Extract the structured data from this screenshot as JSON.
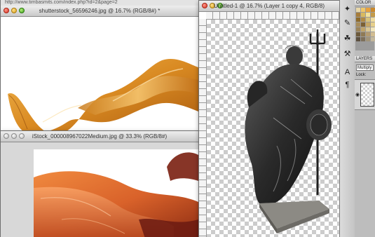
{
  "shutter_window": {
    "url_text": "http://www.timbasmits.com/index.php?id=2&page=2",
    "title": "shutterstock_56596246.jpg @ 16.7% (RGB/8#) *"
  },
  "istock_window": {
    "title": "iStock_000008967022Medium.jpg @ 33.3% (RGB/8#)"
  },
  "untitled_window": {
    "title": "Untitled-1 @ 16.7% (Layer 1 copy 4, RGB/8)"
  },
  "tools": [
    {
      "icon": "character-icon",
      "glyph": "✦"
    },
    {
      "icon": "brush-preset-icon",
      "glyph": "✎"
    },
    {
      "icon": "clone-source-icon",
      "glyph": "☘"
    },
    {
      "icon": "tool-presets-icon",
      "glyph": "⚒"
    },
    {
      "icon": "type-icon",
      "glyph": "A"
    },
    {
      "icon": "paragraph-icon",
      "glyph": "¶"
    }
  ],
  "panels": {
    "color_tab": "COLOR",
    "layers_tab": "LAYERS",
    "blend_mode": "Multiply",
    "lock_label": "Lock:",
    "eye_glyph": "◉"
  },
  "swatch_colors": [
    "#e8d7a8",
    "#f0c76a",
    "#e9a13b",
    "#c9892e",
    "#a67c3a",
    "#d9b95e",
    "#f4e29a",
    "#c49b4a",
    "#8e6b2b",
    "#b08a45",
    "#d8c27a",
    "#efdca0",
    "#a88d5b",
    "#7b6034",
    "#c7a764",
    "#e6cf8c",
    "#9c8459",
    "#bfa46a",
    "#d9c694",
    "#f2e6bc",
    "#6d5a3c",
    "#8f7a55",
    "#b49b70",
    "#d2bd92",
    "#5c5040",
    "#7d6f5a",
    "#a29479",
    "#c4b89c"
  ]
}
